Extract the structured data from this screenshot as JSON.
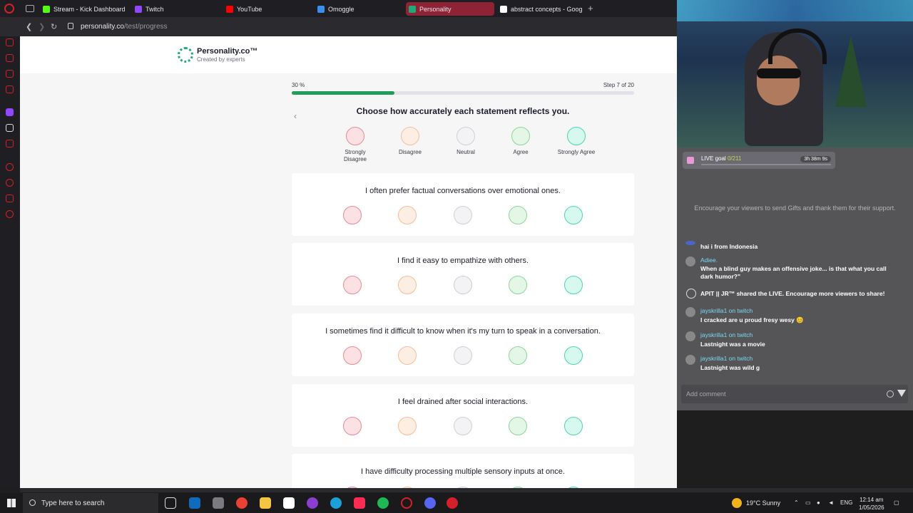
{
  "browser": {
    "tabs": [
      {
        "label": "Stream - Kick Dashboard",
        "color": "#53fc18"
      },
      {
        "label": "Twitch",
        "color": "#9146ff"
      },
      {
        "label": "YouTube",
        "color": "#ff0000"
      },
      {
        "label": "Omoggle",
        "color": "#3a8ef0"
      },
      {
        "label": "Personality",
        "color": "#1fa97b",
        "active": true
      },
      {
        "label": "abstract concepts - Goog",
        "color": "#ffffff"
      }
    ],
    "url_host": "personality.co",
    "url_path": "/test/progress"
  },
  "site": {
    "name": "Personality.co™",
    "tagline": "Created by experts"
  },
  "progress": {
    "percent_label": "30 %",
    "step_label": "Step 7 of 20",
    "fraction": 0.3
  },
  "question_prompt": "Choose how accurately each statement reflects you.",
  "scale": [
    {
      "label": "Strongly Disagree",
      "border": "#e98b95",
      "fill": "#fbe1e4"
    },
    {
      "label": "Disagree",
      "border": "#f2bf9c",
      "fill": "#fdeee3"
    },
    {
      "label": "Neutral",
      "border": "#cfcfd6",
      "fill": "#f3f3f5"
    },
    {
      "label": "Agree",
      "border": "#8bd79a",
      "fill": "#e4f7e7"
    },
    {
      "label": "Strongly Agree",
      "border": "#4fd6ad",
      "fill": "#d7f8ee"
    }
  ],
  "statements": [
    "I often prefer factual conversations over emotional ones.",
    "I find it easy to empathize with others.",
    "I sometimes find it difficult to know when it's my turn to speak in a conversation.",
    "I feel drained after social interactions.",
    "I have difficulty processing multiple sensory inputs at once."
  ],
  "chat": {
    "goal_title": "LIVE goal",
    "goal_count": "0/211",
    "goal_time": "3h 38m 9s",
    "hint": "Encourage your viewers to send Gifts and thank them for their support.",
    "messages": [
      {
        "name": "",
        "text": "hai i from Indonesia"
      },
      {
        "name": "Adiee.",
        "text": "When a blind guy makes an offensive joke... is that what you call dark humor?\""
      },
      {
        "name": "",
        "text": "APIT || JR™ shared the LIVE. Encourage more viewers to share!"
      },
      {
        "name": "jayskrilla1 on twitch",
        "text": "I cracked are u proud fresy wesy 😊"
      },
      {
        "name": "jayskrilla1 on twitch",
        "text": "Lastnight was a movie"
      },
      {
        "name": "jayskrilla1 on twitch",
        "text": "Lastnight was wild g"
      }
    ],
    "comment_placeholder": "Add comment"
  },
  "taskbar": {
    "search_placeholder": "Type here to search",
    "weather": "19°C  Sunny",
    "lang": "ENG",
    "time": "12:14 am",
    "date": "1/05/2026"
  }
}
